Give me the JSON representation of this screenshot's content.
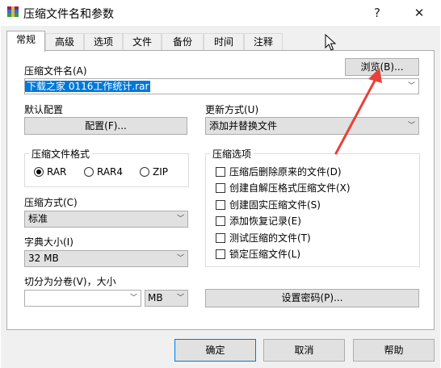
{
  "window": {
    "title": "压缩文件名和参数",
    "help_glyph": "?",
    "close_glyph": "✕"
  },
  "tabs": [
    {
      "label": "常规",
      "active": true
    },
    {
      "label": "高级"
    },
    {
      "label": "选项"
    },
    {
      "label": "文件"
    },
    {
      "label": "备份"
    },
    {
      "label": "时间"
    },
    {
      "label": "注释"
    }
  ],
  "archive_name": {
    "label": "压缩文件名(A)",
    "value": "下载之家 0116工作统计.rar",
    "browse_label": "浏览(B)..."
  },
  "default_profile": {
    "label": "默认配置",
    "button_label": "配置(F)..."
  },
  "update_mode": {
    "label": "更新方式(U)",
    "value": "添加并替换文件"
  },
  "archive_format": {
    "label": "压缩文件格式",
    "options": [
      {
        "label": "RAR",
        "selected": true
      },
      {
        "label": "RAR4",
        "selected": false
      },
      {
        "label": "ZIP",
        "selected": false
      }
    ]
  },
  "compression_method": {
    "label": "压缩方式(C)",
    "value": "标准"
  },
  "dictionary_size": {
    "label": "字典大小(I)",
    "value": "32 MB"
  },
  "split_volumes": {
    "label": "切分为分卷(V)，大小",
    "value": "",
    "unit": "MB"
  },
  "archive_options": {
    "label": "压缩选项",
    "items": [
      {
        "label": "压缩后删除原来的文件(D)",
        "checked": false
      },
      {
        "label": "创建自解压格式压缩文件(X)",
        "checked": false
      },
      {
        "label": "创建固实压缩文件(S)",
        "checked": false
      },
      {
        "label": "添加恢复记录(E)",
        "checked": false
      },
      {
        "label": "测试压缩的文件(T)",
        "checked": false
      },
      {
        "label": "锁定压缩文件(L)",
        "checked": false
      }
    ]
  },
  "set_password_label": "设置密码(P)...",
  "footer": {
    "ok_label": "确定",
    "cancel_label": "取消",
    "help_label": "帮助"
  },
  "annotation": {
    "color": "#e8413a"
  }
}
